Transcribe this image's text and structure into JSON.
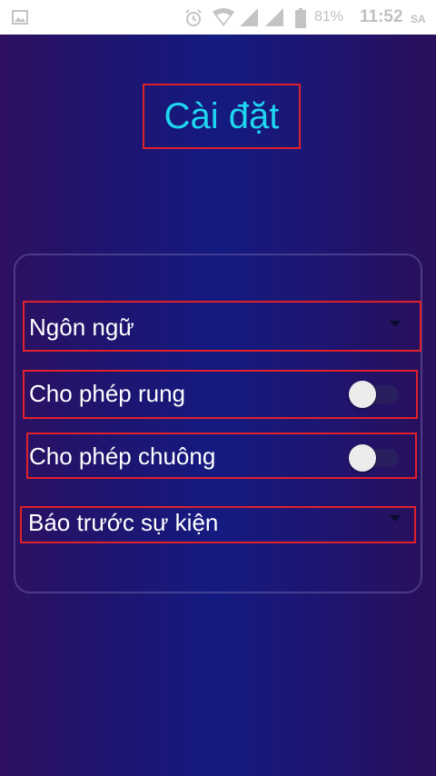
{
  "status_bar": {
    "battery_percent": "81%",
    "time": "11:52",
    "ampm": "SA"
  },
  "screen": {
    "title": "Cài đặt"
  },
  "settings": {
    "language_label": "Ngôn ngữ",
    "vibrate_label": "Cho phép rung",
    "vibrate_enabled": false,
    "ring_label": "Cho phép chuông",
    "ring_enabled": false,
    "event_reminder_label": "Báo trước sự kiện"
  },
  "colors": {
    "title": "#1fd6f0",
    "highlight_border": "#e0202a",
    "text": "#ffffff"
  }
}
